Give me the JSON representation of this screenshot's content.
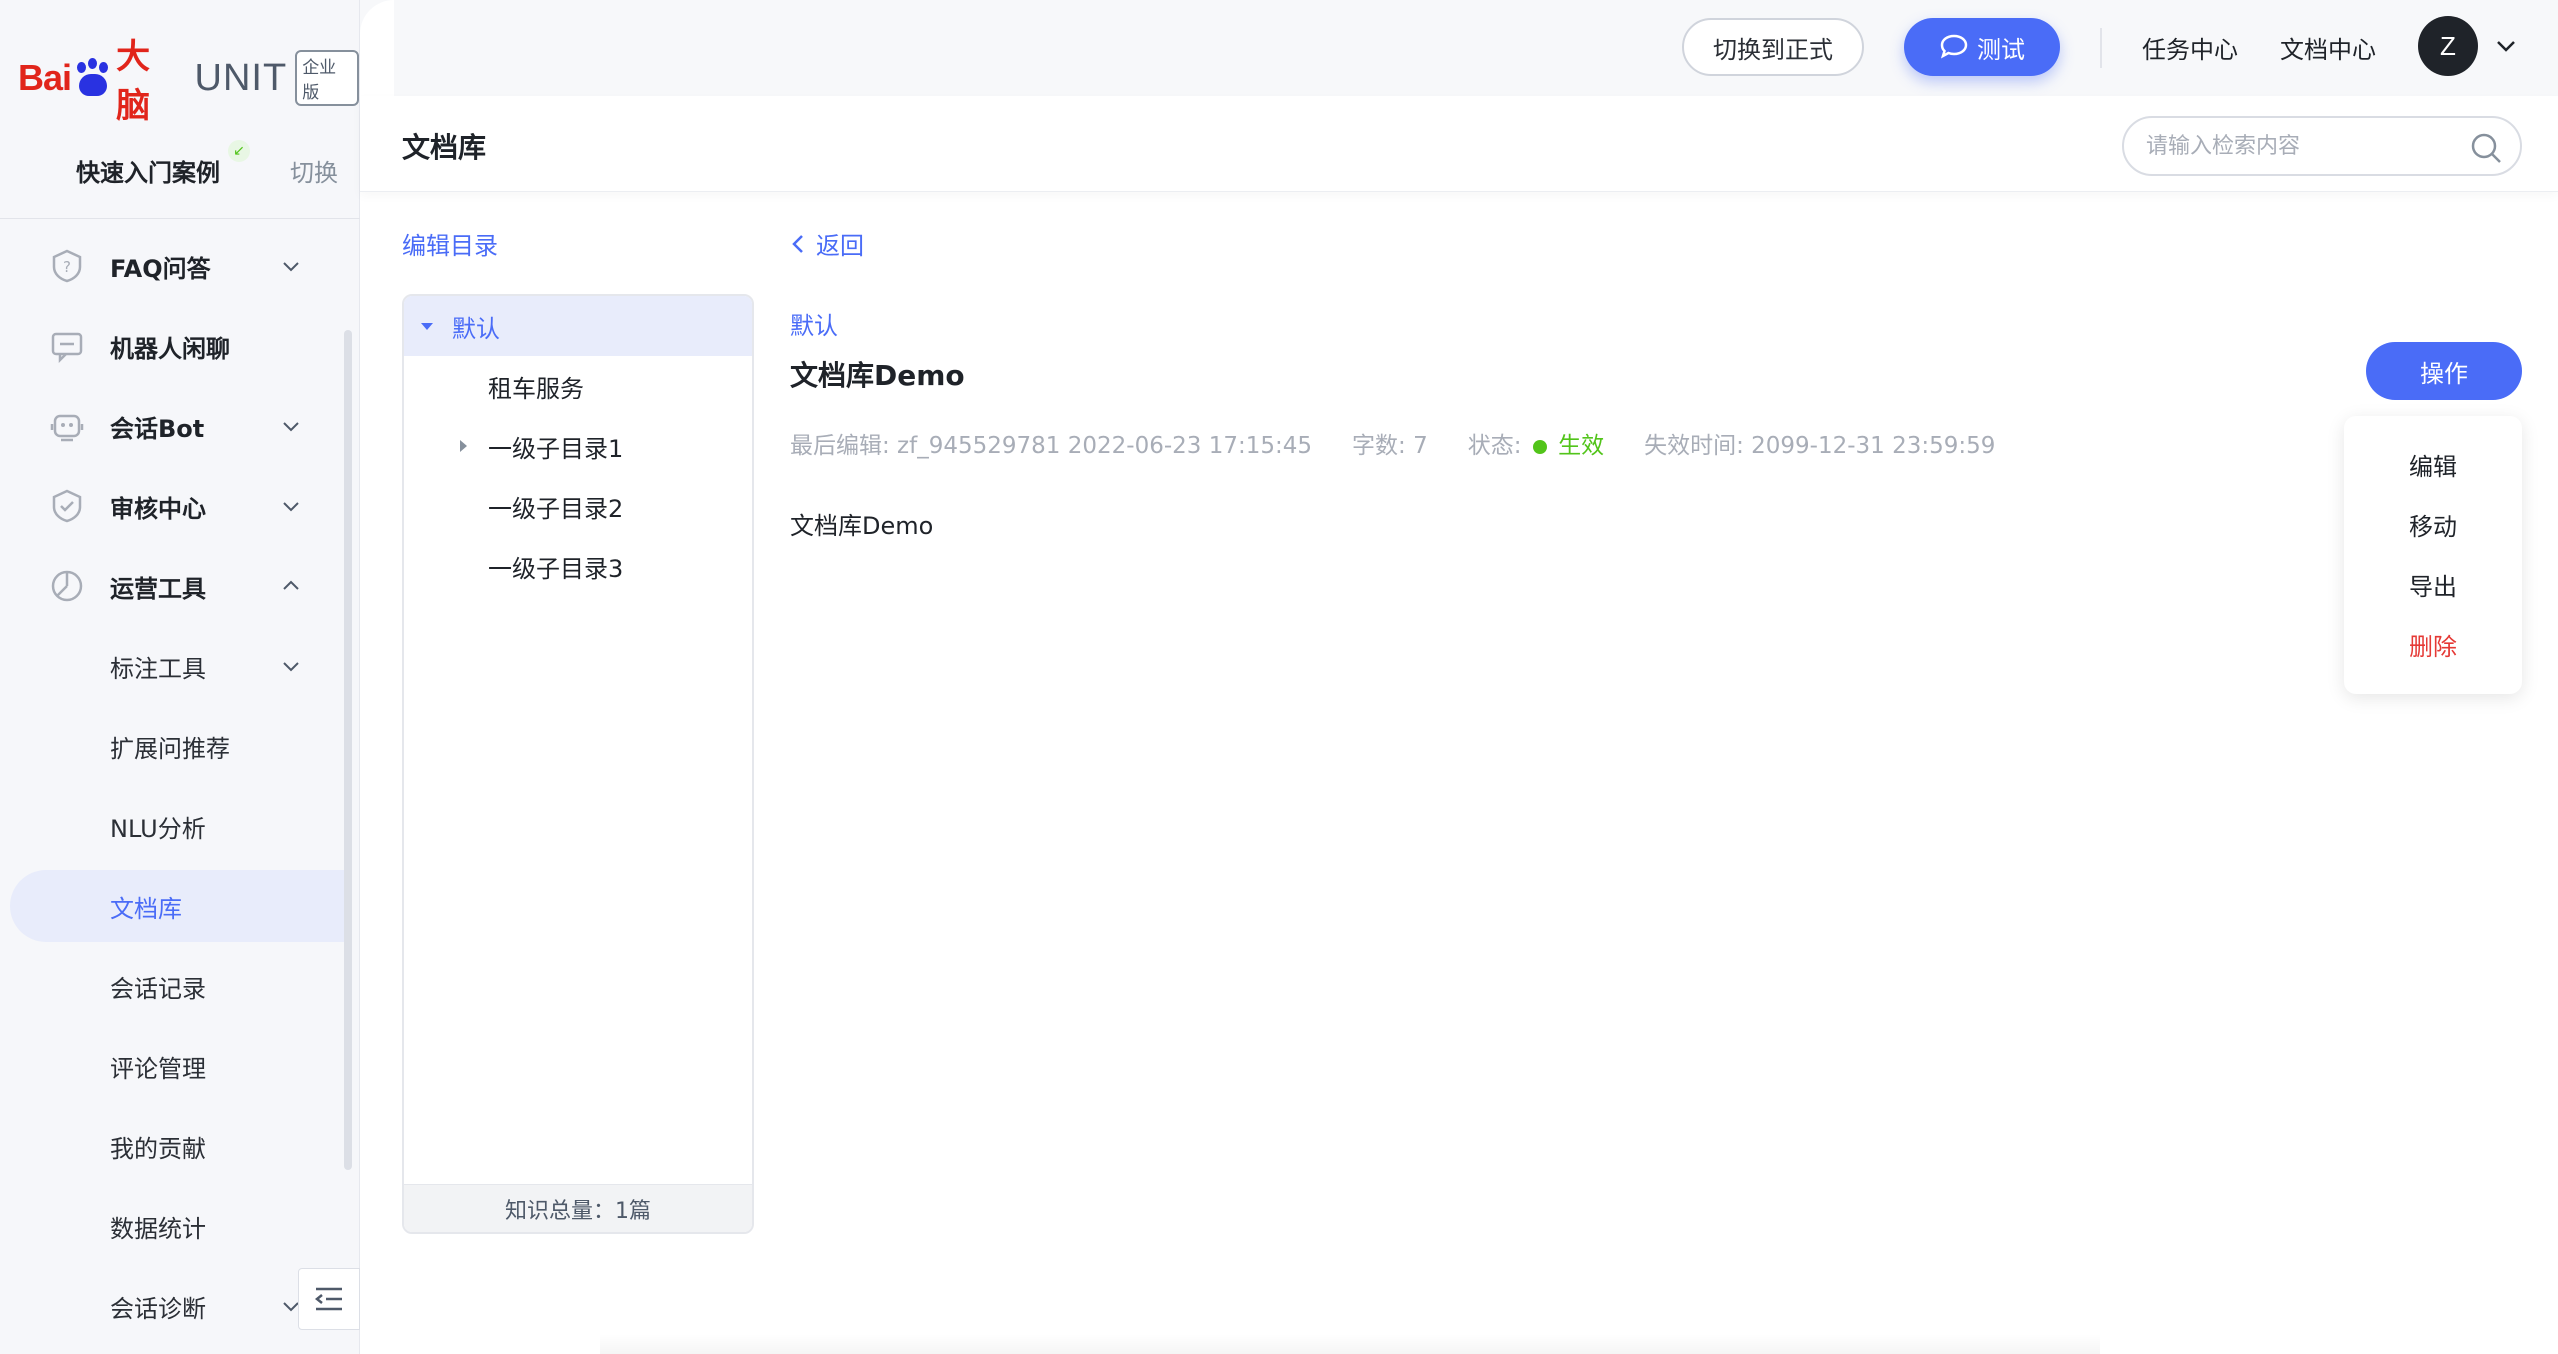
{
  "brand": {
    "bai": "Bai",
    "du": "du",
    "naocn": "大脑",
    "unit": "UNIT",
    "edition": "企业版"
  },
  "case": {
    "name": "快速入门案例",
    "switch_label": "切换"
  },
  "sidebar": {
    "items": [
      {
        "label": "FAQ问答",
        "icon": "question-shield-icon",
        "expandable": true,
        "expanded": false
      },
      {
        "label": "机器人闲聊",
        "icon": "chat-bubble-icon",
        "expandable": false
      },
      {
        "label": "会话Bot",
        "icon": "robot-icon",
        "expandable": true,
        "expanded": false
      },
      {
        "label": "审核中心",
        "icon": "check-shield-icon",
        "expandable": true,
        "expanded": false
      },
      {
        "label": "运营工具",
        "icon": "pie-chart-icon",
        "expandable": true,
        "expanded": true
      }
    ],
    "sub_items": [
      {
        "label": "标注工具",
        "expandable": true
      },
      {
        "label": "扩展问推荐"
      },
      {
        "label": "NLU分析"
      },
      {
        "label": "文档库",
        "active": true
      },
      {
        "label": "会话记录"
      },
      {
        "label": "评论管理"
      },
      {
        "label": "我的贡献"
      },
      {
        "label": "数据统计"
      },
      {
        "label": "会话诊断",
        "expandable": true
      }
    ]
  },
  "topbar": {
    "switch_formal": "切换到正式",
    "test": "测试",
    "task_center": "任务中心",
    "doc_center": "文档中心",
    "avatar_letter": "Z"
  },
  "page": {
    "title": "文档库",
    "search_placeholder": "请输入检索内容",
    "edit_dir": "编辑目录",
    "back": "返回"
  },
  "tree": {
    "root": "默认",
    "children": [
      {
        "label": "租车服务",
        "has_children": false
      },
      {
        "label": "一级子目录1",
        "has_children": true
      },
      {
        "label": "一级子目录2",
        "has_children": false
      },
      {
        "label": "一级子目录3",
        "has_children": false
      }
    ],
    "footer": "知识总量：1篇"
  },
  "doc": {
    "crumb": "默认",
    "title": "文档库Demo",
    "last_edit": "最后编辑: zf_945529781 2022-06-23 17:15:45",
    "word_count": "字数: 7",
    "status_label": "状态:",
    "status_value": "生效",
    "expire": "失效时间: 2099-12-31 23:59:59",
    "body": "文档库Demo"
  },
  "actions": {
    "op_button": "操作",
    "menu": [
      "编辑",
      "移动",
      "导出",
      "删除"
    ]
  },
  "colors": {
    "accent": "#4a6cf7",
    "brand_red": "#e1251b",
    "brand_blue": "#2932e1",
    "status_green": "#52c41a",
    "danger": "#e53935"
  }
}
